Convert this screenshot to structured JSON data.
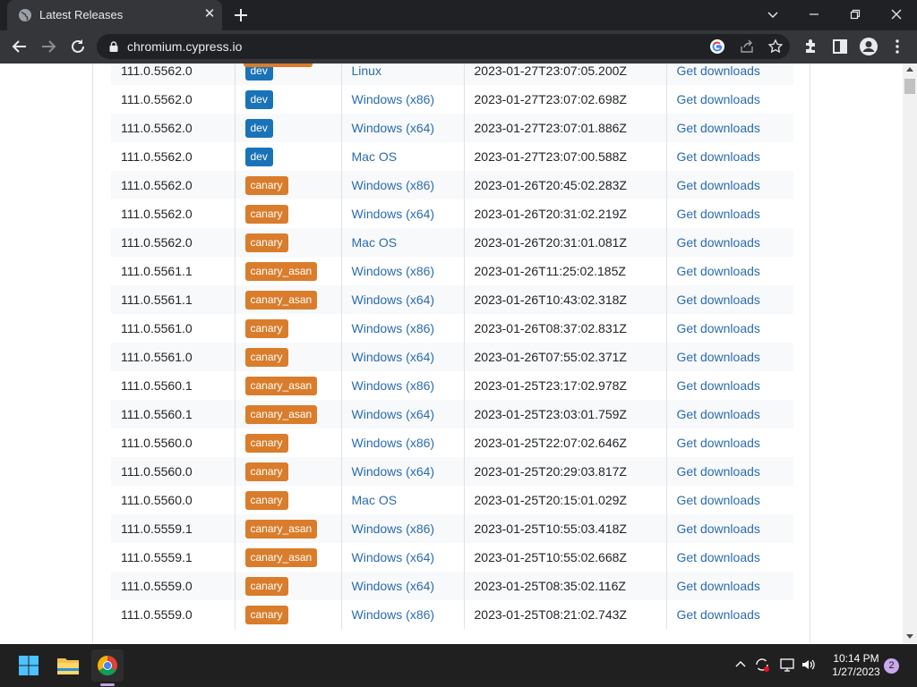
{
  "browser": {
    "tab_title": "Latest Releases",
    "url": "chromium.cypress.io"
  },
  "releases": [
    {
      "version": "111.0.5562.0",
      "channel": "dev",
      "os": "Linux",
      "timestamp": "2023-01-27T23:07:05.200Z",
      "action": "Get downloads"
    },
    {
      "version": "111.0.5562.0",
      "channel": "dev",
      "os": "Windows (x86)",
      "timestamp": "2023-01-27T23:07:02.698Z",
      "action": "Get downloads"
    },
    {
      "version": "111.0.5562.0",
      "channel": "dev",
      "os": "Windows (x64)",
      "timestamp": "2023-01-27T23:07:01.886Z",
      "action": "Get downloads"
    },
    {
      "version": "111.0.5562.0",
      "channel": "dev",
      "os": "Mac OS",
      "timestamp": "2023-01-27T23:07:00.588Z",
      "action": "Get downloads"
    },
    {
      "version": "111.0.5562.0",
      "channel": "canary",
      "os": "Windows (x86)",
      "timestamp": "2023-01-26T20:45:02.283Z",
      "action": "Get downloads"
    },
    {
      "version": "111.0.5562.0",
      "channel": "canary",
      "os": "Windows (x64)",
      "timestamp": "2023-01-26T20:31:02.219Z",
      "action": "Get downloads"
    },
    {
      "version": "111.0.5562.0",
      "channel": "canary",
      "os": "Mac OS",
      "timestamp": "2023-01-26T20:31:01.081Z",
      "action": "Get downloads"
    },
    {
      "version": "111.0.5561.1",
      "channel": "canary_asan",
      "os": "Windows (x86)",
      "timestamp": "2023-01-26T11:25:02.185Z",
      "action": "Get downloads"
    },
    {
      "version": "111.0.5561.1",
      "channel": "canary_asan",
      "os": "Windows (x64)",
      "timestamp": "2023-01-26T10:43:02.318Z",
      "action": "Get downloads"
    },
    {
      "version": "111.0.5561.0",
      "channel": "canary",
      "os": "Windows (x86)",
      "timestamp": "2023-01-26T08:37:02.831Z",
      "action": "Get downloads"
    },
    {
      "version": "111.0.5561.0",
      "channel": "canary",
      "os": "Windows (x64)",
      "timestamp": "2023-01-26T07:55:02.371Z",
      "action": "Get downloads"
    },
    {
      "version": "111.0.5560.1",
      "channel": "canary_asan",
      "os": "Windows (x86)",
      "timestamp": "2023-01-25T23:17:02.978Z",
      "action": "Get downloads"
    },
    {
      "version": "111.0.5560.1",
      "channel": "canary_asan",
      "os": "Windows (x64)",
      "timestamp": "2023-01-25T23:03:01.759Z",
      "action": "Get downloads"
    },
    {
      "version": "111.0.5560.0",
      "channel": "canary",
      "os": "Windows (x86)",
      "timestamp": "2023-01-25T22:07:02.646Z",
      "action": "Get downloads"
    },
    {
      "version": "111.0.5560.0",
      "channel": "canary",
      "os": "Windows (x64)",
      "timestamp": "2023-01-25T20:29:03.817Z",
      "action": "Get downloads"
    },
    {
      "version": "111.0.5560.0",
      "channel": "canary",
      "os": "Mac OS",
      "timestamp": "2023-01-25T20:15:01.029Z",
      "action": "Get downloads"
    },
    {
      "version": "111.0.5559.1",
      "channel": "canary_asan",
      "os": "Windows (x86)",
      "timestamp": "2023-01-25T10:55:03.418Z",
      "action": "Get downloads"
    },
    {
      "version": "111.0.5559.1",
      "channel": "canary_asan",
      "os": "Windows (x64)",
      "timestamp": "2023-01-25T10:55:02.668Z",
      "action": "Get downloads"
    },
    {
      "version": "111.0.5559.0",
      "channel": "canary",
      "os": "Windows (x64)",
      "timestamp": "2023-01-25T08:35:02.116Z",
      "action": "Get downloads"
    },
    {
      "version": "111.0.5559.0",
      "channel": "canary",
      "os": "Windows (x86)",
      "timestamp": "2023-01-25T08:21:02.743Z",
      "action": "Get downloads"
    }
  ],
  "taskbar": {
    "time": "10:14 PM",
    "date": "1/27/2023",
    "notification_count": "2"
  },
  "colors": {
    "dev_badge": "#1a73b8",
    "canary_badge": "#d97d2c",
    "link": "#2b6cb0"
  },
  "icons": [
    "globe-icon",
    "close-icon",
    "plus-icon",
    "chevron-down-icon",
    "minimize-icon",
    "restore-icon",
    "back-icon",
    "forward-icon",
    "reload-icon",
    "lock-icon",
    "google-icon",
    "share-icon",
    "star-icon",
    "extensions-icon",
    "sidepanel-icon",
    "profile-icon",
    "menu-icon",
    "windows-start-icon",
    "file-explorer-icon",
    "chrome-icon",
    "chevron-up-icon",
    "sync-icon",
    "network-icon",
    "volume-icon"
  ]
}
